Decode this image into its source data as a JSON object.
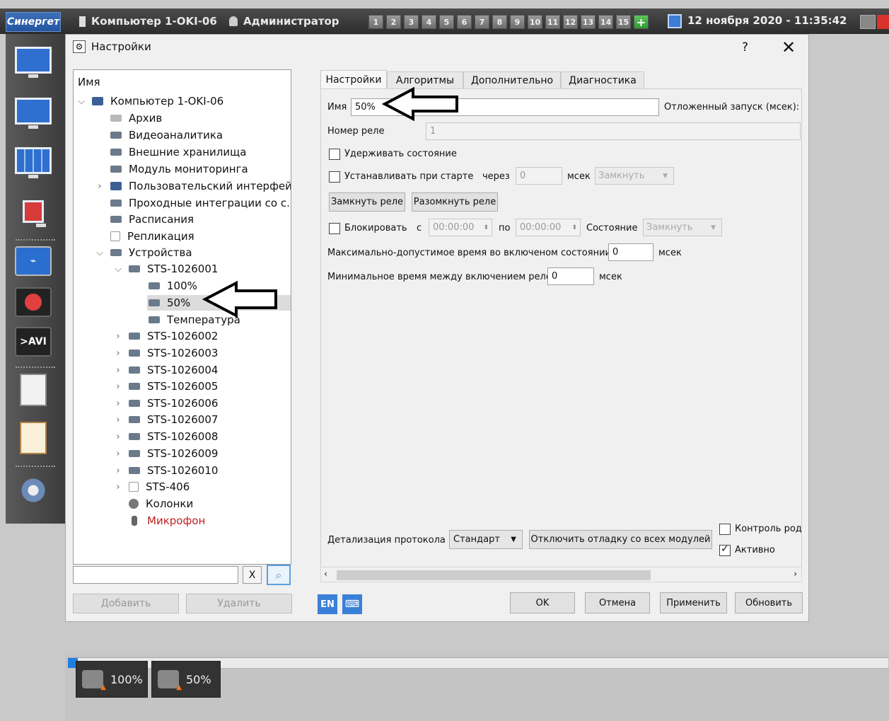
{
  "topbar": {
    "brand": "Синергет",
    "computer": "Компьютер 1-OKI-06",
    "user": "Администратор",
    "screens": [
      "1",
      "2",
      "3",
      "4",
      "5",
      "6",
      "7",
      "8",
      "9",
      "10",
      "11",
      "12",
      "13",
      "14",
      "15"
    ],
    "add_screen": "+",
    "datetime": "12 ноября 2020 - 11:35:42"
  },
  "left_toolbar": {
    "avi_label": ">AVI"
  },
  "dialog": {
    "title": "Настройки",
    "help": "?",
    "close": "✕",
    "tree": {
      "header": "Имя",
      "items": [
        {
          "label": "Компьютер 1-OKI-06",
          "expander": "⌵"
        },
        {
          "label": "Архив"
        },
        {
          "label": "Видеоаналитика"
        },
        {
          "label": "Внешние хранилища"
        },
        {
          "label": "Модуль мониторинга"
        },
        {
          "label": "Пользовательский интерфейс",
          "expander": "›"
        },
        {
          "label": "Проходные интеграции со с..."
        },
        {
          "label": "Расписания"
        },
        {
          "label": "Репликация"
        },
        {
          "label": "Устройства",
          "expander": "⌵"
        },
        {
          "label": "STS-1026001",
          "expander": "⌵"
        },
        {
          "label": "100%"
        },
        {
          "label": "50%"
        },
        {
          "label": "Температура"
        },
        {
          "label": "STS-1026002",
          "expander": "›"
        },
        {
          "label": "STS-1026003",
          "expander": "›"
        },
        {
          "label": "STS-1026004",
          "expander": "›"
        },
        {
          "label": "STS-1026005",
          "expander": "›"
        },
        {
          "label": "STS-1026006",
          "expander": "›"
        },
        {
          "label": "STS-1026007",
          "expander": "›"
        },
        {
          "label": "STS-1026008",
          "expander": "›"
        },
        {
          "label": "STS-1026009",
          "expander": "›"
        },
        {
          "label": "STS-1026010",
          "expander": "›"
        },
        {
          "label": "STS-406",
          "expander": "›"
        },
        {
          "label": "Колонки"
        },
        {
          "label": "Микрофон"
        }
      ],
      "search_value": "",
      "search_clear": "X",
      "search_icon": "🔍"
    },
    "add_button": "Добавить",
    "delete_button": "Удалить",
    "tabs": [
      "Настройки",
      "Алгоритмы",
      "Дополнительно",
      "Диагностика"
    ],
    "settings": {
      "name_label": "Имя",
      "name_value": "50%",
      "delayed_start_label": "Отложенный запуск (мсек):",
      "relay_number_label": "Номер реле",
      "relay_number_value": "1",
      "hold_state_label": "Удерживать состояние",
      "set_on_start_label": "Устанавливать при старте",
      "after_label": "через",
      "after_value": "0",
      "msec_label": "мсек",
      "start_state_value": "Замкнуть",
      "close_relay_button": "Замкнуть реле",
      "open_relay_button": "Разомкнуть реле",
      "block_label": "Блокировать",
      "from_label": "с",
      "from_value": "00:00:00",
      "to_label": "по",
      "to_value": "00:00:00",
      "state_label": "Состояние",
      "state_value": "Замкнуть",
      "max_on_time_label": "Максимально-допустимое время во включеном состоянии",
      "max_on_time_value": "0",
      "max_on_time_unit": "мсек",
      "min_between_label": "Минимальное время между включением реле",
      "min_between_value": "0",
      "min_between_unit": "мсек"
    },
    "protocol_label": "Детализация протокола",
    "protocol_value": "Стандарт",
    "disable_debug_button": "Отключить отладку со всех модулей",
    "control_label": "Контроль род",
    "active_label": "Активно",
    "lang_badge": "EN",
    "ok_button": "OK",
    "cancel_button": "Отмена",
    "apply_button": "Применить",
    "refresh_button": "Обновить"
  },
  "bottom": {
    "cameras": [
      {
        "label": "100%"
      },
      {
        "label": "50%"
      }
    ]
  }
}
